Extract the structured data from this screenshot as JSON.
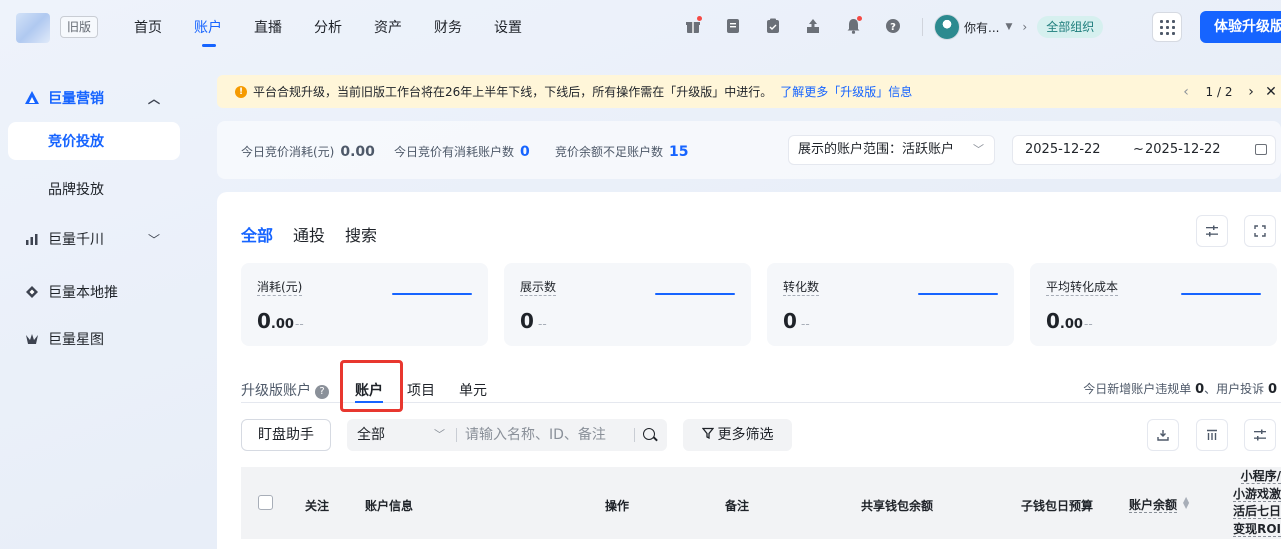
{
  "topbar": {
    "old_version": "旧版",
    "nav": [
      "首页",
      "账户",
      "直播",
      "分析",
      "资产",
      "财务",
      "设置"
    ],
    "active_nav": 1,
    "user_name": "你有...",
    "org": "全部组织",
    "upgrade": "体验升级版"
  },
  "sidebar": {
    "items": [
      {
        "label": "巨量营销",
        "icon": "triangle-logo-icon"
      },
      {
        "label": "竞价投放"
      },
      {
        "label": "品牌投放"
      },
      {
        "label": "巨量千川",
        "icon": "chart-bars-icon"
      },
      {
        "label": "巨量本地推",
        "icon": "diamond-icon"
      },
      {
        "label": "巨量星图",
        "icon": "star-icon"
      }
    ]
  },
  "notice": {
    "text": "平台合规升级，当前旧版工作台将在26年上半年下线，下线后，所有操作需在「升级版」中进行。",
    "link": "了解更多「升级版」信息",
    "page": "1 / 2"
  },
  "summary": {
    "spend_label": "今日竞价消耗(元)",
    "spend_value": "0.00",
    "active_label": "今日竞价有消耗账户数",
    "active_value": "0",
    "low_label": "竞价余额不足账户数",
    "low_value": "15",
    "scope": "展示的账户范围：活跃账户",
    "date_from": "2025-12-22",
    "date_sep": "~",
    "date_to": "2025-12-22"
  },
  "main": {
    "tabs": [
      "全部",
      "通投",
      "搜索"
    ],
    "metrics": [
      {
        "label": "消耗(元)",
        "int": "0",
        "dec": ".00",
        "delta": "--"
      },
      {
        "label": "展示数",
        "int": "0",
        "dec": "",
        "delta": "--"
      },
      {
        "label": "转化数",
        "int": "0",
        "dec": "",
        "delta": "--"
      },
      {
        "label": "平均转化成本",
        "int": "0",
        "dec": ".00",
        "delta": "--"
      }
    ],
    "sub_tabs": [
      "升级版账户",
      "账户",
      "项目",
      "单元"
    ],
    "violation": "今日新增账户违规单",
    "violation_count": "0",
    "complaint": "、用户投诉",
    "complaint_count": "0",
    "watch_btn": "盯盘助手",
    "filter_select": "全部",
    "search_placeholder": "请输入名称、ID、备注",
    "more_filter": "更多筛选"
  },
  "table": {
    "headers": [
      "关注",
      "账户信息",
      "操作",
      "备注",
      "共享钱包余额",
      "子钱包日预算",
      "账户余额",
      "小程序/小游戏激活后七日变现ROI"
    ],
    "last_lines": [
      "小程序/",
      "小游戏激",
      "活后七日",
      "变现ROI"
    ]
  },
  "colors": {
    "accent": "#1664ff",
    "warning_bg": "#fff6d9",
    "highlight": "#e8372f"
  }
}
